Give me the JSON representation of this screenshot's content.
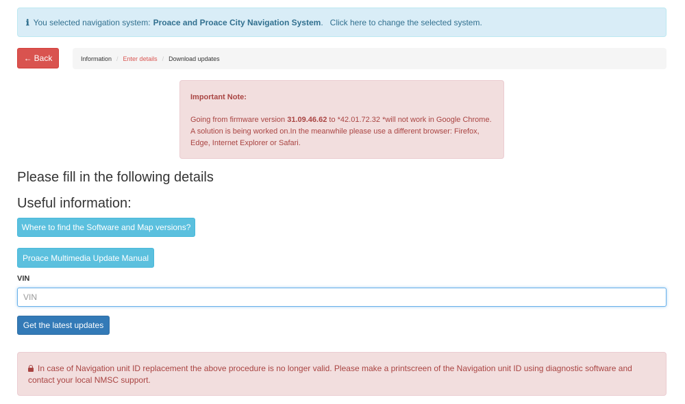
{
  "info_alert": {
    "icon": "info-icon",
    "prefix": "You selected navigation system:",
    "system": "Proace and Proace City Navigation System",
    "suffix": ".",
    "change_link": "Click here to change the selected system."
  },
  "back_button": {
    "arrow": "←",
    "label": "Back"
  },
  "breadcrumb": {
    "items": [
      "Information",
      "Enter details",
      "Download updates"
    ],
    "separator": "/"
  },
  "note": {
    "title": "Important Note:",
    "text_before": "Going from firmware version ",
    "version": "31.09.46.62",
    "text_after": " to *42.01.72.32 *will not work in Google Chrome. A solution is being worked on.In the meanwhile please use a different browser: Firefox, Edge, Internet Explorer or Safari."
  },
  "headings": {
    "fill": "Please fill in the following details",
    "useful": "Useful information:"
  },
  "buttons": {
    "where": "Where to find the Software and Map versions?",
    "manual": "Proace Multimedia Update Manual",
    "submit": "Get the latest updates"
  },
  "vin": {
    "label": "VIN",
    "placeholder": "VIN",
    "value": ""
  },
  "danger_alert": {
    "icon": "lock-icon",
    "text": "In case of Navigation unit ID replacement the above procedure is no longer valid. Please make a printscreen of the Navigation unit ID using diagnostic software and contact your local NMSC support."
  },
  "colors": {
    "info_bg": "#d9edf7",
    "danger": "#d9534f",
    "info_button": "#5bc0de",
    "primary": "#337ab7",
    "alert_text": "#a94442"
  }
}
